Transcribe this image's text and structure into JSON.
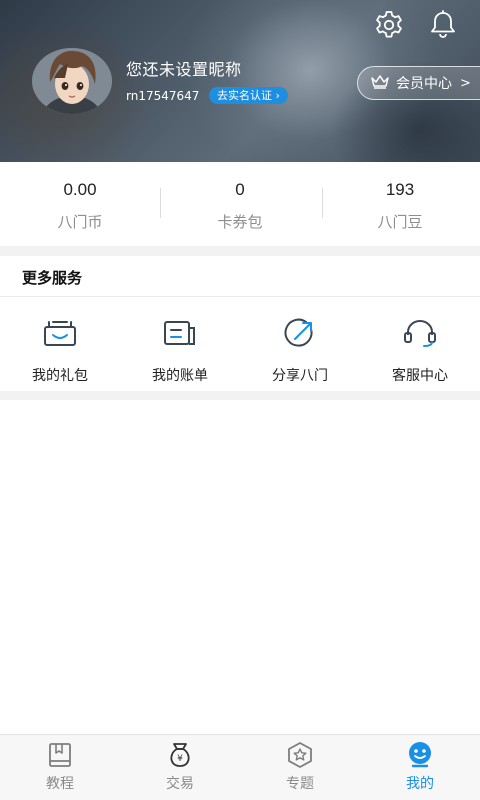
{
  "header": {
    "nickname": "您还未设置昵称",
    "user_id": "rn17547647",
    "verify_badge": "去实名认证 ›",
    "member_center": "会员中心",
    "member_chevron": ">",
    "icons": [
      "gear-icon",
      "bell-icon",
      "crown-icon"
    ]
  },
  "stats": [
    {
      "value": "0.00",
      "label": "八门币"
    },
    {
      "value": "0",
      "label": "卡券包"
    },
    {
      "value": "193",
      "label": "八门豆"
    }
  ],
  "services": {
    "title": "更多服务",
    "items": [
      {
        "label": "我的礼包",
        "icon": "gift-icon"
      },
      {
        "label": "我的账单",
        "icon": "bill-icon"
      },
      {
        "label": "分享八门",
        "icon": "share-icon"
      },
      {
        "label": "客服中心",
        "icon": "headset-icon"
      }
    ]
  },
  "bottom_nav": {
    "active_color": "#1a8fe6",
    "inactive_color": "#8a8a8a",
    "items": [
      {
        "label": "教程",
        "icon": "book-icon",
        "active": false
      },
      {
        "label": "交易",
        "icon": "money-bag-icon",
        "active": false
      },
      {
        "label": "专题",
        "icon": "star-badge-icon",
        "active": false
      },
      {
        "label": "我的",
        "icon": "profile-face-icon",
        "active": true
      }
    ]
  }
}
